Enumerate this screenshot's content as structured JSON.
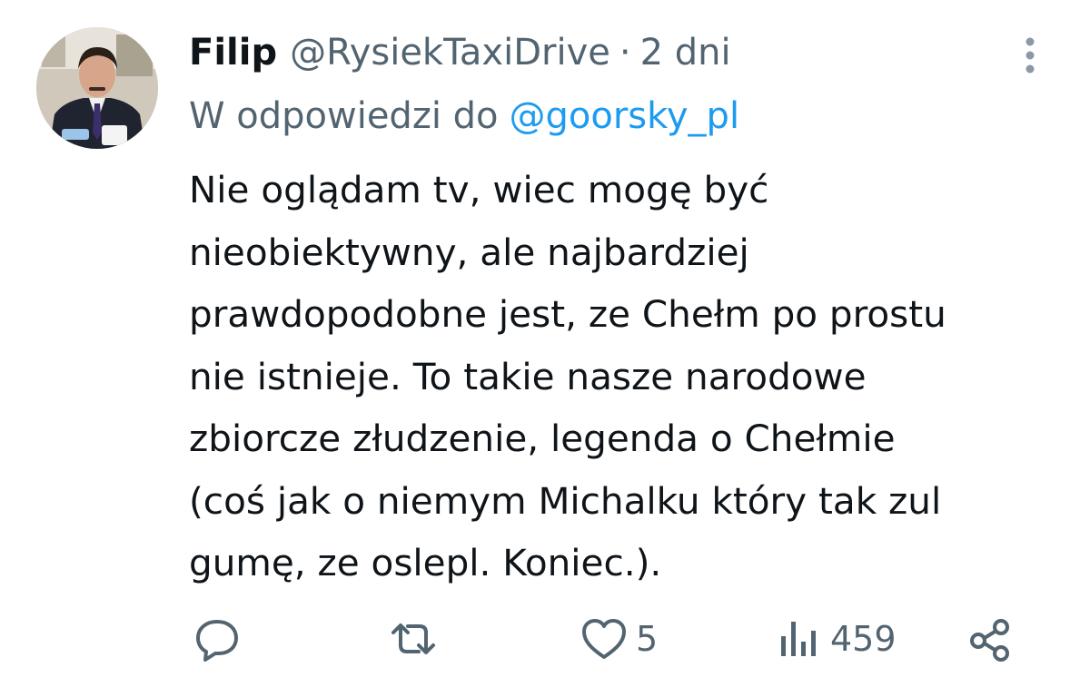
{
  "tweet": {
    "author_name": "Filip",
    "author_handle": "@RysiekTaxiDrive",
    "separator": "·",
    "time": "2 dni",
    "reply_prefix": "W odpowiedzi do",
    "reply_mention": "@goorsky_pl",
    "text_lines": [
      "Nie oglądam tv, wiec mogę być",
      "nieobiektywny, ale najbardziej",
      "prawdopodobne jest, ze Chełm po prostu",
      "nie istnieje. To takie nasze narodowe",
      "zbiorcze złudzenie, legenda o Chełmie",
      "(coś jak o niemym Michalku który tak zul",
      "gumę, ze oslepl. Koniec.)."
    ]
  },
  "actions": {
    "reply_icon": "reply-icon",
    "retweet_icon": "retweet-icon",
    "like_icon": "heart-icon",
    "like_count": "5",
    "views_icon": "views-icon",
    "views_count": "459",
    "share_icon": "share-icon"
  },
  "colors": {
    "text": "#0f1419",
    "secondary": "#536471",
    "link": "#1d9bf0"
  }
}
